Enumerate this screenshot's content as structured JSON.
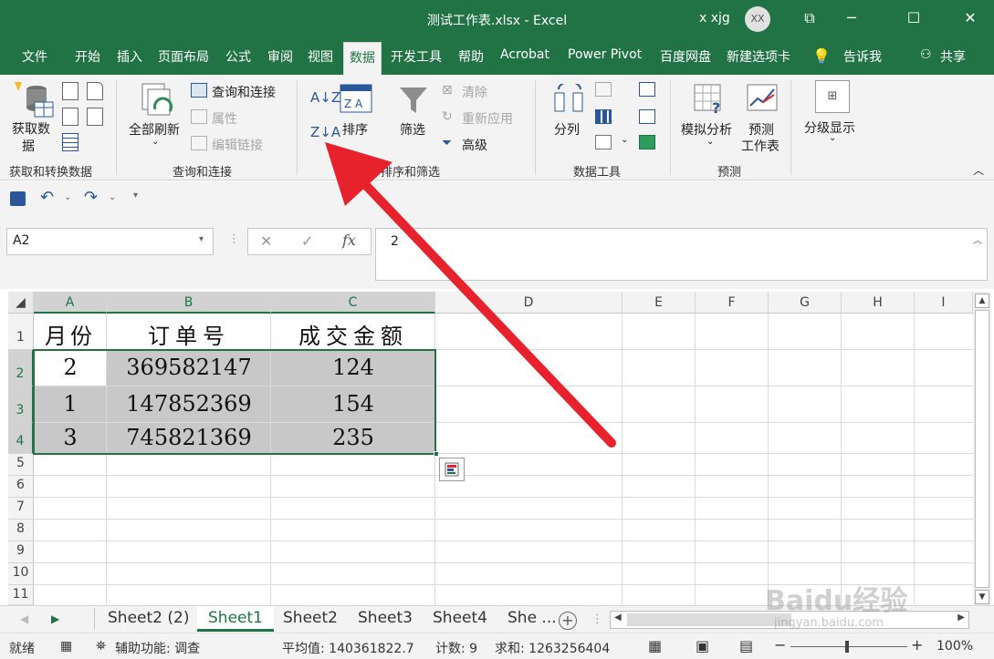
{
  "titlebar": {
    "title": "测试工作表.xlsx  -  Excel",
    "user": "x xjg",
    "avatar": "XX"
  },
  "ribbon_tabs": [
    "文件",
    "开始",
    "插入",
    "页面布局",
    "公式",
    "审阅",
    "视图",
    "数据",
    "开发工具",
    "帮助",
    "Acrobat",
    "Power Pivot",
    "百度网盘",
    "新建选项卡",
    "告诉我",
    "共享"
  ],
  "active_tab": "数据",
  "groups": {
    "get_transform": {
      "label": "获取和转换数据",
      "get_data": "获取数",
      "get_data2": "据"
    },
    "queries": {
      "label": "查询和连接",
      "refresh_all": "全部刷新",
      "queries_connections": "查询和连接",
      "properties": "属性",
      "edit_links": "编辑链接"
    },
    "sort_filter": {
      "label": "排序和筛选",
      "sort": "排序",
      "filter": "筛选",
      "clear": "清除",
      "reapply": "重新应用",
      "advanced": "高级",
      "az": "A↓Z",
      "za": "Z↓A"
    },
    "data_tools": {
      "label": "数据工具",
      "text_to_columns": "分列"
    },
    "forecast": {
      "label": "预测",
      "what_if": "模拟分析",
      "forecast_sheet": "预测",
      "forecast_sheet2": "工作表"
    },
    "outline": {
      "label": "分级显示"
    }
  },
  "namebox": "A2",
  "formula": "2",
  "columns": [
    "A",
    "B",
    "C",
    "D",
    "E",
    "F",
    "G",
    "H",
    "I"
  ],
  "rows": [
    "1",
    "2",
    "3",
    "4",
    "5",
    "6",
    "7",
    "8",
    "9",
    "10",
    "11"
  ],
  "table": {
    "header": [
      "月份",
      "订单号",
      "成交金额"
    ],
    "rows": [
      [
        "2",
        "369582147",
        "124"
      ],
      [
        "1",
        "147852369",
        "154"
      ],
      [
        "3",
        "745821369",
        "235"
      ]
    ]
  },
  "sheets": [
    "Sheet2 (2)",
    "Sheet1",
    "Sheet2",
    "Sheet3",
    "Sheet4",
    "She ..."
  ],
  "active_sheet": "Sheet1",
  "status": {
    "ready": "就绪",
    "accessibility": "辅助功能: 调查",
    "average": "平均值: 140361822.7",
    "count": "计数: 9",
    "sum": "求和: 1263256404",
    "zoom": "100%"
  },
  "watermark": {
    "brand": "Baidu经验",
    "url": "jingyan.baidu.com"
  },
  "colors": {
    "excel_green": "#217346",
    "arrow_red": "#e8222d",
    "selection_gray": "#c8c8c8"
  }
}
